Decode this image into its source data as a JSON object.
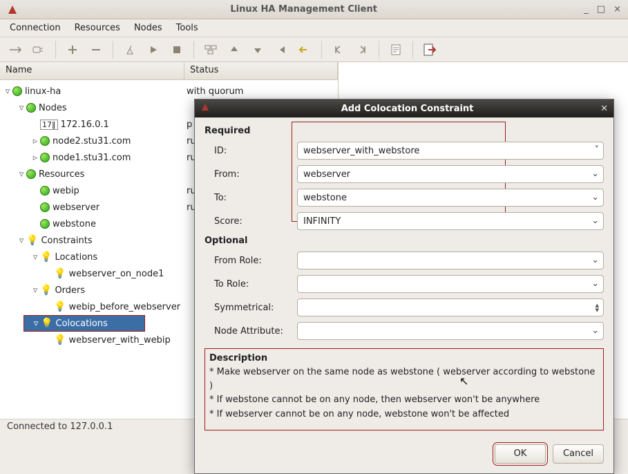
{
  "window": {
    "title": "Linux HA Management Client"
  },
  "menubar": [
    "Connection",
    "Resources",
    "Nodes",
    "Tools"
  ],
  "columns": {
    "name": "Name",
    "status": "Status"
  },
  "tree": {
    "root": {
      "label": "linux-ha",
      "status": "with quorum"
    },
    "nodes_label": "Nodes",
    "nodes": [
      {
        "ip": "172.16.0.1"
      },
      {
        "host": "node2.stu31.com"
      },
      {
        "host": "node1.stu31.com"
      }
    ],
    "resources_label": "Resources",
    "resources": [
      "webip",
      "webserver",
      "webstone"
    ],
    "constraints_label": "Constraints",
    "locations_label": "Locations",
    "locations": [
      "webserver_on_node1"
    ],
    "orders_label": "Orders",
    "orders": [
      "webip_before_webserver"
    ],
    "colocations_label": "Colocations",
    "colocations": [
      "webserver_with_webip"
    ]
  },
  "hidden_status": [
    "p",
    "ru",
    "ru",
    "ru",
    "ru"
  ],
  "dialog": {
    "title": "Add Colocation Constraint",
    "required_label": "Required",
    "optional_label": "Optional",
    "fields": {
      "id_label": "ID:",
      "id_value": "webserver_with_webstore",
      "from_label": "From:",
      "from_value": "webserver",
      "to_label": "To:",
      "to_value": "webstone",
      "score_label": "Score:",
      "score_value": "INFINITY",
      "from_role_label": "From Role:",
      "from_role_value": "",
      "to_role_label": "To Role:",
      "to_role_value": "",
      "symmetrical_label": "Symmetrical:",
      "symmetrical_value": "",
      "node_attr_label": "Node Attribute:",
      "node_attr_value": ""
    },
    "description_label": "Description",
    "description_lines": [
      "* Make webserver  on the same node as webstone   ( webserver according to webstone )",
      "* If webstone cannot be  on any node, then webserver won't be  anywhere",
      "* If webserver cannot be  on any node, webstone won't be affected"
    ],
    "buttons": {
      "ok": "OK",
      "cancel": "Cancel"
    }
  },
  "statusbar": "Connected to 127.0.0.1"
}
